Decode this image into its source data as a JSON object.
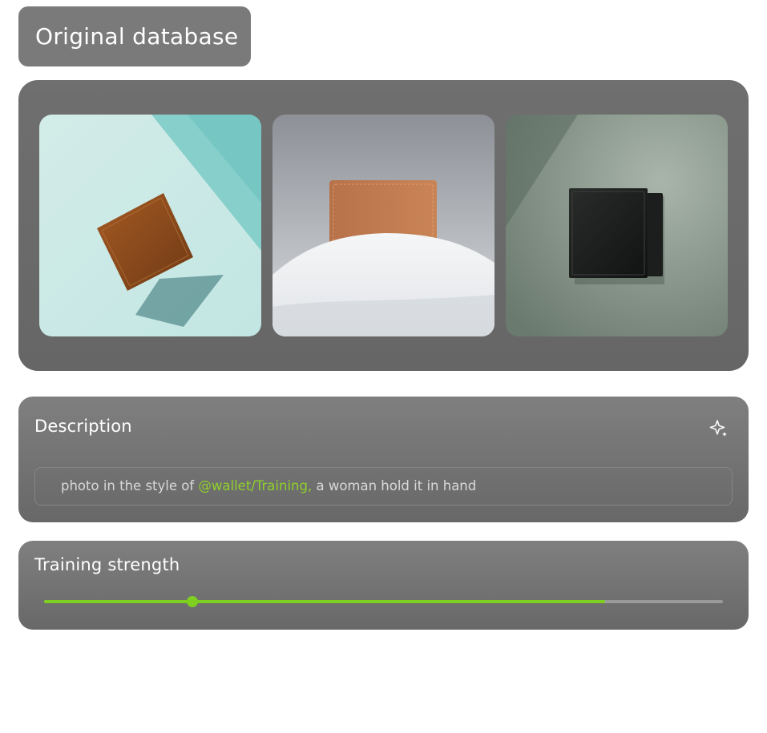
{
  "header": {
    "title": "Original database"
  },
  "gallery": {
    "images": [
      {
        "subject": "brown leather wallet on teal background"
      },
      {
        "subject": "tan leather wallet in snow"
      },
      {
        "subject": "black leather wallet on sage green background"
      }
    ]
  },
  "description": {
    "label": "Description",
    "icon": "sparkle-icon",
    "prompt_prefix": "photo in the style of ",
    "prompt_mention": "@wallet/Training,",
    "prompt_suffix": " a woman hold it in hand"
  },
  "training": {
    "label": "Training strength",
    "thumb_fraction": 0.218,
    "fill_fraction": 0.827
  },
  "colors": {
    "accent": "#7ecf1f",
    "mention": "#8ed12a",
    "panel": "#6f6f6f"
  }
}
